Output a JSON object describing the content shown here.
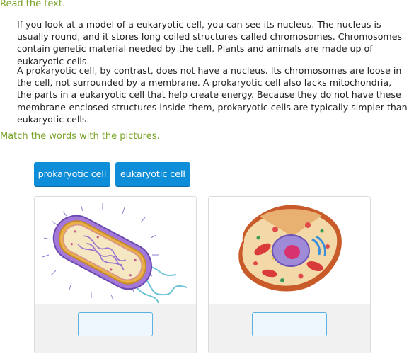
{
  "instructions": {
    "read": "Read the text.",
    "match": "Match the words with the pictures."
  },
  "passage": {
    "paragraph_1": "If you look at a model of a eukaryotic cell, you can see its nucleus. The nucleus is usually round, and it stores long coiled structures called chromosomes. Chromosomes contain genetic material needed by the cell. Plants and animals are made up of eukaryotic cells.",
    "paragraph_2": "A prokaryotic cell, by contrast, does not have a nucleus. Its chromosomes are loose in the cell, not surrounded by a membrane. A prokaryotic cell also lacks mitochondria, the parts in a eukaryotic cell that help create energy. Because they do not have these membrane-enclosed structures inside them, prokaryotic cells are typically simpler than eukaryotic cells."
  },
  "word_bank": {
    "tiles": [
      "prokaryotic cell",
      "eukaryotic cell"
    ]
  },
  "colors": {
    "accent": "#0e8ed8",
    "instruction": "#7aa32a",
    "drop_border": "#5db0e2"
  }
}
